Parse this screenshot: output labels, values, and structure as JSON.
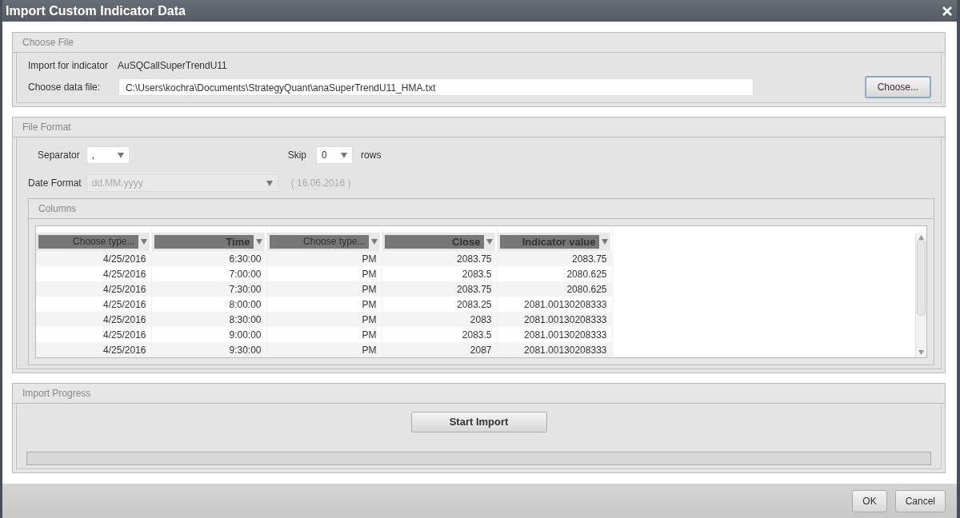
{
  "window": {
    "title": "Import Custom Indicator Data"
  },
  "choose_file": {
    "title": "Choose File",
    "indicator_label": "Import for indicator",
    "indicator_value": "AuSQCallSuperTrendU11",
    "file_label": "Choose data file:",
    "file_value": "C:\\Users\\kochra\\Documents\\StrategyQuant\\anaSuperTrendU11_HMA.txt",
    "button": "Choose..."
  },
  "file_format": {
    "title": "File Format",
    "separator": {
      "label": "Separator",
      "value": ","
    },
    "skip": {
      "label": "Skip",
      "value": "0",
      "suffix": "rows"
    },
    "date_format": {
      "label": "Date Format",
      "value": "dd.MM.yyyy",
      "disabled": true,
      "example": "( 16.06.2016 )"
    },
    "columns": {
      "title": "Columns",
      "headers": [
        {
          "label": "Choose type...",
          "kind": "unset"
        },
        {
          "label": "Time",
          "kind": "set"
        },
        {
          "label": "Choose type...",
          "kind": "unset"
        },
        {
          "label": "Close",
          "kind": "set"
        },
        {
          "label": "Indicator value",
          "kind": "set"
        }
      ],
      "rows": [
        [
          "4/25/2016",
          "6:30:00",
          "PM",
          "2083.75",
          "2083.75"
        ],
        [
          "4/25/2016",
          "7:00:00",
          "PM",
          "2083.5",
          "2080.625"
        ],
        [
          "4/25/2016",
          "7:30:00",
          "PM",
          "2083.75",
          "2080.625"
        ],
        [
          "4/25/2016",
          "8:00:00",
          "PM",
          "2083.25",
          "2081.00130208333"
        ],
        [
          "4/25/2016",
          "8:30:00",
          "PM",
          "2083",
          "2081.00130208333"
        ],
        [
          "4/25/2016",
          "9:00:00",
          "PM",
          "2083.5",
          "2081.00130208333"
        ],
        [
          "4/25/2016",
          "9:30:00",
          "PM",
          "2087",
          "2081.00130208333"
        ]
      ]
    }
  },
  "import_progress": {
    "title": "Import Progress",
    "button": "Start Import",
    "level": 0
  },
  "buttons": [
    "OK",
    "Cancel"
  ]
}
